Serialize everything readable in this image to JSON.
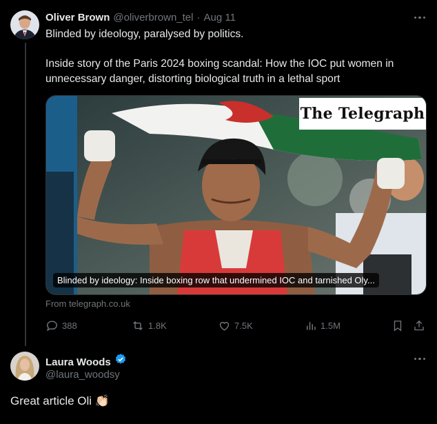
{
  "tweet": {
    "author_name": "Oliver Brown",
    "handle": "@oliverbrown_tel",
    "separator": "·",
    "date": "Aug 11",
    "text_line1": "Blinded by ideology, paralysed by politics.",
    "text_line2": "Inside story of the Paris 2024 boxing scandal: How the IOC put women in",
    "text_line3": "unnecessary danger, distorting biological truth in a lethal sport",
    "card": {
      "logo_text": "The Telegraph",
      "caption": "Blinded by ideology: Inside boxing row that undermined IOC and tarnished Oly...",
      "source": "From telegraph.co.uk"
    },
    "stats": {
      "replies": "388",
      "reposts": "1.8K",
      "likes": "7.5K",
      "views": "1.5M"
    }
  },
  "reply": {
    "author_name": "Laura Woods",
    "handle": "@laura_woodsy",
    "text": "Great article Oli",
    "emoji": "👏🏻"
  },
  "colors": {
    "background": "#000000",
    "text": "#e7e9ea",
    "muted": "#71767b",
    "verified": "#1d9bf0"
  }
}
